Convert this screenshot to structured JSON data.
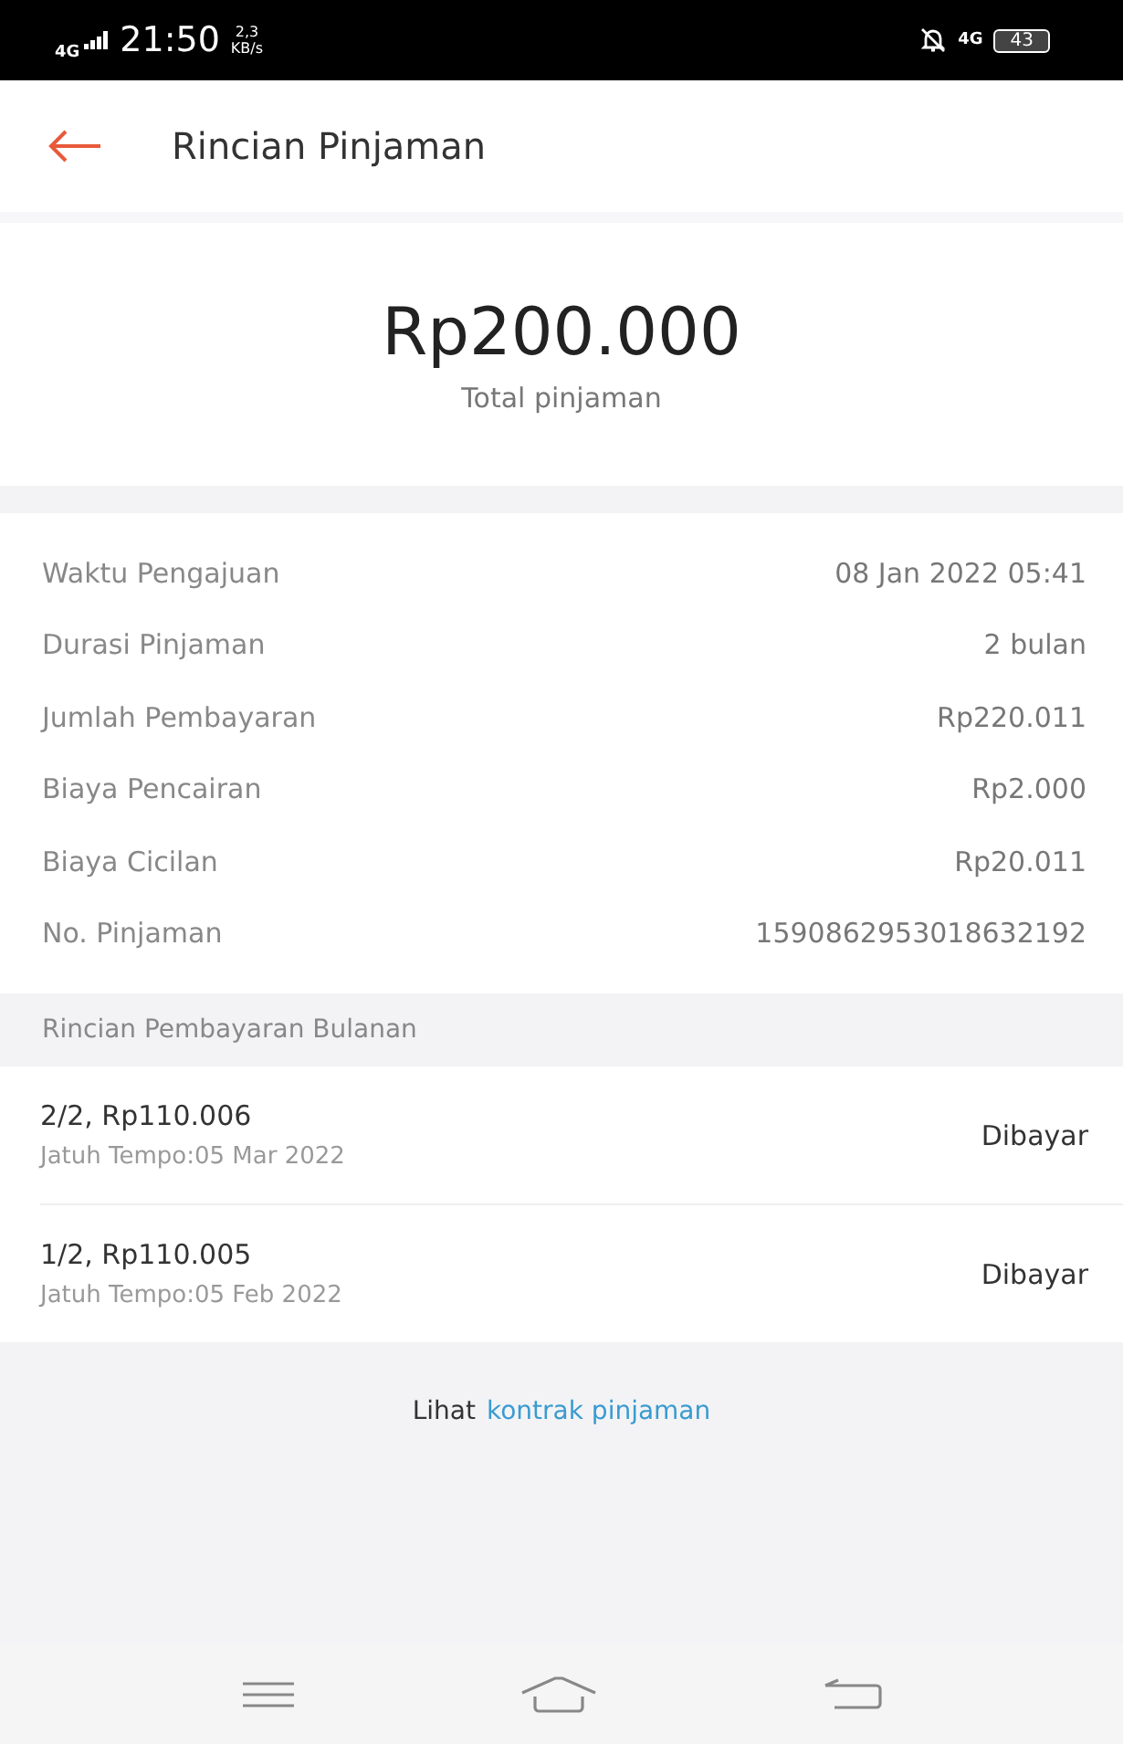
{
  "status_bar": {
    "network": "4G",
    "time": "21:50",
    "speed_value": "2,3",
    "speed_unit": "KB/s",
    "network_right": "4G",
    "battery": "43"
  },
  "header": {
    "title": "Rincian Pinjaman"
  },
  "summary": {
    "amount": "Rp200.000",
    "caption": "Total pinjaman"
  },
  "details": [
    {
      "label": "Waktu Pengajuan",
      "value": "08 Jan 2022 05:41"
    },
    {
      "label": "Durasi Pinjaman",
      "value": "2 bulan"
    },
    {
      "label": "Jumlah Pembayaran",
      "value": "Rp220.011"
    },
    {
      "label": "Biaya Pencairan",
      "value": "Rp2.000"
    },
    {
      "label": "Biaya Cicilan",
      "value": "Rp20.011"
    },
    {
      "label": "No. Pinjaman",
      "value": "1590862953018632192"
    }
  ],
  "installments": {
    "heading": "Rincian Pembayaran Bulanan",
    "items": [
      {
        "title": "2/2, Rp110.006",
        "due": "Jatuh Tempo:05 Mar 2022",
        "status": "Dibayar"
      },
      {
        "title": "1/2, Rp110.005",
        "due": "Jatuh Tempo:05 Feb 2022",
        "status": "Dibayar"
      }
    ]
  },
  "footer": {
    "prefix": "Lihat",
    "link": "kontrak pinjaman"
  }
}
